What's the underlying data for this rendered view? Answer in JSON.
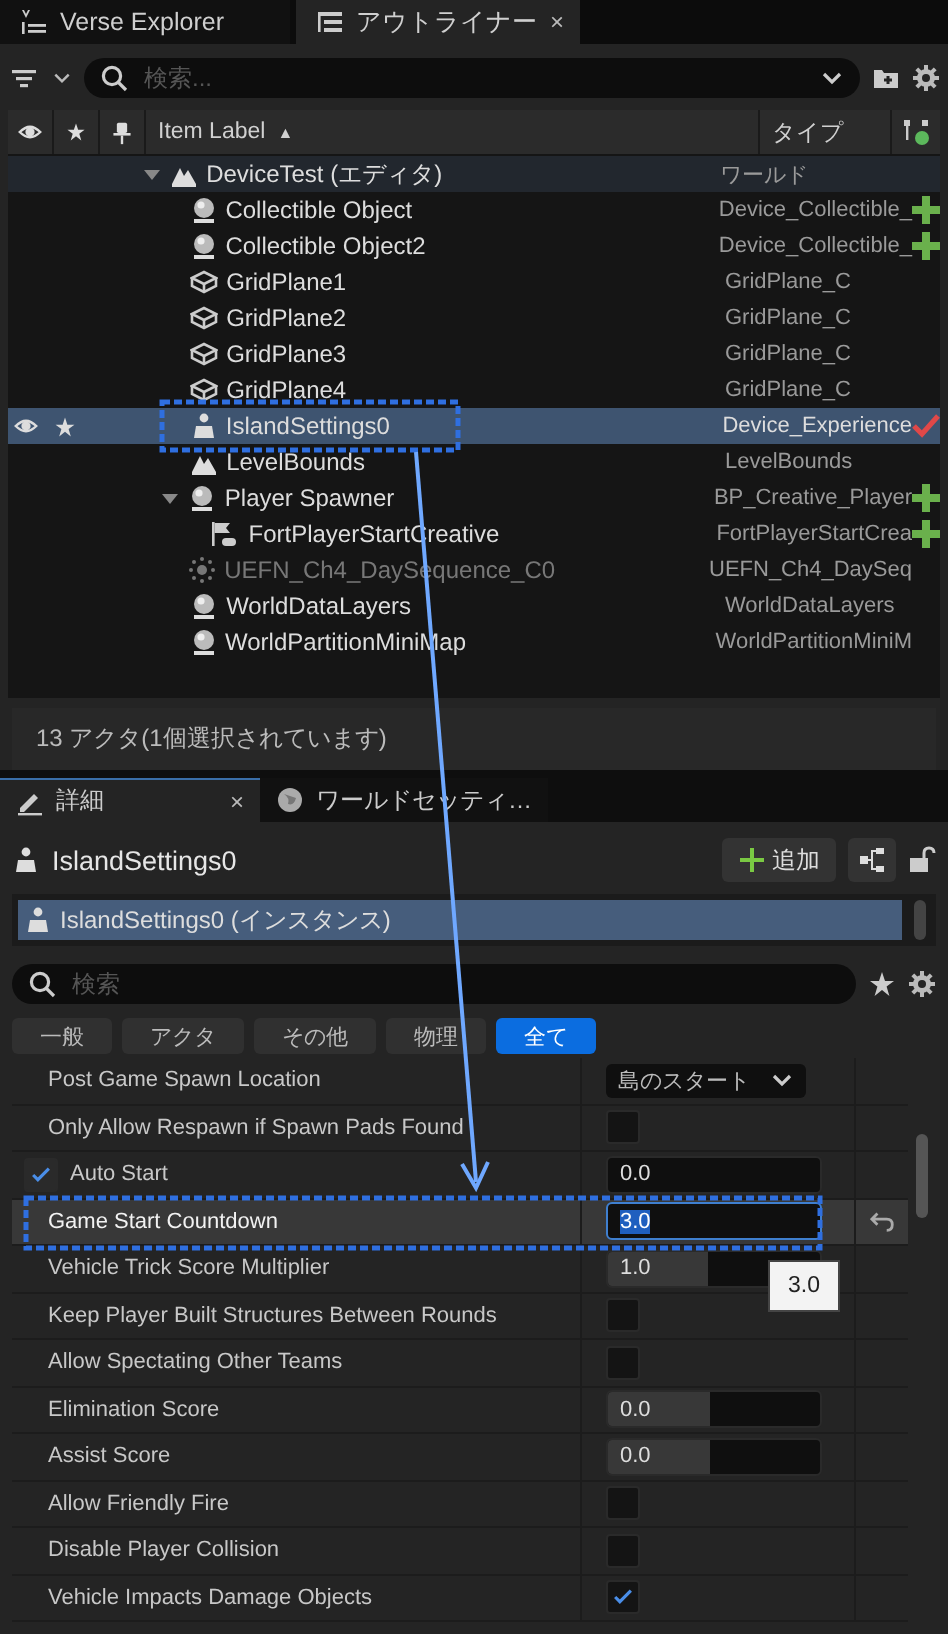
{
  "top_tabs": [
    {
      "label": "Verse Explorer",
      "kind": "verse",
      "selected": false
    },
    {
      "label": "アウトライナー",
      "kind": "outliner",
      "selected": true,
      "close": "×"
    }
  ],
  "outliner": {
    "search": {
      "placeholder": "検索..."
    },
    "columns": {
      "label": "Item Label",
      "sort": "▲",
      "type": "タイプ"
    },
    "tree": [
      {
        "label": "DeviceTest (エディタ)",
        "type": "ワールド",
        "kind": "world",
        "expanded": true,
        "selected": false,
        "disabled": false,
        "added": false,
        "modified": false,
        "children": [
          {
            "label": "Collectible Object",
            "type": "Device_Collectible_",
            "kind": "sphere",
            "added": true,
            "modified": false,
            "selected": false,
            "disabled": false
          },
          {
            "label": "Collectible Object2",
            "type": "Device_Collectible_",
            "kind": "sphere",
            "added": true,
            "modified": false,
            "selected": false,
            "disabled": false
          },
          {
            "label": "GridPlane1",
            "type": "GridPlane_C",
            "kind": "bricks",
            "added": false,
            "modified": false,
            "selected": false,
            "disabled": false
          },
          {
            "label": "GridPlane2",
            "type": "GridPlane_C",
            "kind": "bricks",
            "added": false,
            "modified": false,
            "selected": false,
            "disabled": false
          },
          {
            "label": "GridPlane3",
            "type": "GridPlane_C",
            "kind": "bricks",
            "added": false,
            "modified": false,
            "selected": false,
            "disabled": false
          },
          {
            "label": "GridPlane4",
            "type": "GridPlane_C",
            "kind": "bricks",
            "added": false,
            "modified": false,
            "selected": false,
            "disabled": false
          },
          {
            "label": "IslandSettings0",
            "type": "Device_Experience",
            "kind": "island",
            "added": false,
            "modified": true,
            "selected": true,
            "disabled": false
          },
          {
            "label": "LevelBounds",
            "type": "LevelBounds",
            "kind": "world",
            "added": false,
            "modified": false,
            "selected": false,
            "disabled": false
          },
          {
            "label": "Player Spawner",
            "type": "BP_Creative_Player",
            "kind": "sphere",
            "added": true,
            "modified": false,
            "expanded": true,
            "selected": false,
            "disabled": false,
            "children": [
              {
                "label": "FortPlayerStartCreative",
                "type": "FortPlayerStartCrea",
                "kind": "flag",
                "added": true,
                "modified": false,
                "selected": false,
                "disabled": false
              }
            ]
          },
          {
            "label": "UEFN_Ch4_DaySequence_C0",
            "type": "UEFN_Ch4_DaySeq",
            "kind": "sun",
            "added": false,
            "modified": false,
            "selected": false,
            "disabled": true
          },
          {
            "label": "WorldDataLayers",
            "type": "WorldDataLayers",
            "kind": "sphere",
            "added": false,
            "modified": false,
            "selected": false,
            "disabled": false
          },
          {
            "label": "WorldPartitionMiniMap",
            "type": "WorldPartitionMiniM",
            "kind": "sphere",
            "added": false,
            "modified": false,
            "selected": false,
            "disabled": false
          }
        ]
      }
    ],
    "status_bar": "13 アクタ(1個選択されています)"
  },
  "detail_tabs": [
    {
      "label": "詳細",
      "kind": "pencil",
      "selected": true,
      "close": "×"
    },
    {
      "label": "ワールドセッティ…",
      "kind": "globe",
      "selected": false
    }
  ],
  "details": {
    "title": "IslandSettings0",
    "add_button": "追加",
    "components": [
      {
        "label": "IslandSettings0 (インスタンス)",
        "selected": true
      }
    ],
    "search": {
      "placeholder": "検索"
    },
    "filters": [
      {
        "label": "一般",
        "selected": false
      },
      {
        "label": "アクタ",
        "selected": false
      },
      {
        "label": "その他",
        "selected": false
      },
      {
        "label": "物理",
        "selected": false
      },
      {
        "label": "全て",
        "selected": true
      }
    ],
    "properties": [
      {
        "label": "Post Game Spawn Location",
        "kind": "dropdown",
        "value": "島のスタート",
        "selected": false
      },
      {
        "label": "Only Allow Respawn if Spawn Pads Found",
        "kind": "checkbox",
        "checked": false,
        "selected": false
      },
      {
        "label": "Auto Start",
        "kind": "number",
        "value": "0.0",
        "edit_condition": true,
        "selected": false
      },
      {
        "label": "Game Start Countdown",
        "kind": "number",
        "value": "3.0",
        "selected": true,
        "reset": true
      },
      {
        "label": "Vehicle Trick Score Multiplier",
        "kind": "slider",
        "value": "1.0",
        "level": 0.47,
        "selected": false
      },
      {
        "label": "Keep Player Built Structures Between Rounds",
        "kind": "checkbox",
        "checked": false,
        "selected": false
      },
      {
        "label": "Allow Spectating Other Teams",
        "kind": "checkbox",
        "checked": false,
        "selected": false
      },
      {
        "label": "Elimination Score",
        "kind": "slider",
        "value": "0.0",
        "level": 0.48,
        "selected": false
      },
      {
        "label": "Assist Score",
        "kind": "slider",
        "value": "0.0",
        "level": 0.48,
        "selected": false
      },
      {
        "label": "Allow Friendly Fire",
        "kind": "checkbox",
        "checked": false,
        "selected": false
      },
      {
        "label": "Disable Player Collision",
        "kind": "checkbox",
        "checked": false,
        "selected": false
      },
      {
        "label": "Vehicle Impacts Damage Objects",
        "kind": "checkbox",
        "checked": true,
        "selected": false
      }
    ],
    "tooltip": "3.0"
  }
}
